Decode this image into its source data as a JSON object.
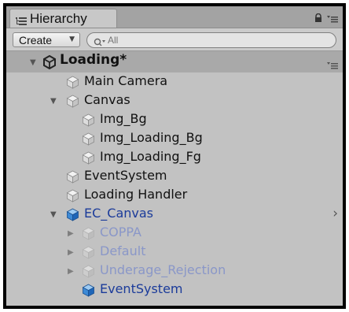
{
  "window": {
    "tab_label": "Hierarchy",
    "tab_icon": "hierarchy-list-icon"
  },
  "toolbar": {
    "create_label": "Create",
    "search_placeholder": "All"
  },
  "scene": {
    "name": "Loading*",
    "icon": "unity-scene-icon",
    "expanded": true
  },
  "tree": [
    {
      "label": "Main Camera",
      "depth": 1,
      "expander": "none",
      "style": "normal"
    },
    {
      "label": "Canvas",
      "depth": 1,
      "expander": "expanded",
      "style": "normal"
    },
    {
      "label": "Img_Bg",
      "depth": 2,
      "expander": "none",
      "style": "normal"
    },
    {
      "label": "Img_Loading_Bg",
      "depth": 2,
      "expander": "none",
      "style": "normal"
    },
    {
      "label": "Img_Loading_Fg",
      "depth": 2,
      "expander": "none",
      "style": "normal"
    },
    {
      "label": "EventSystem",
      "depth": 1,
      "expander": "none",
      "style": "normal"
    },
    {
      "label": "Loading Handler",
      "depth": 1,
      "expander": "none",
      "style": "normal"
    },
    {
      "label": "EC_Canvas",
      "depth": 1,
      "expander": "expanded",
      "style": "prefab"
    },
    {
      "label": "COPPA",
      "depth": 2,
      "expander": "collapsed",
      "style": "prefab-inactive"
    },
    {
      "label": "Default",
      "depth": 2,
      "expander": "collapsed",
      "style": "prefab-inactive"
    },
    {
      "label": "Underage_Rejection",
      "depth": 2,
      "expander": "collapsed",
      "style": "prefab-inactive"
    },
    {
      "label": "EventSystem",
      "depth": 2,
      "expander": "none",
      "style": "prefab"
    }
  ],
  "colors": {
    "panel_bg": "#c2c2c2",
    "scene_row_bg": "#a9a9a9",
    "prefab_text": "#1b3b9a",
    "prefab_inactive_text": "#8a97c8"
  }
}
